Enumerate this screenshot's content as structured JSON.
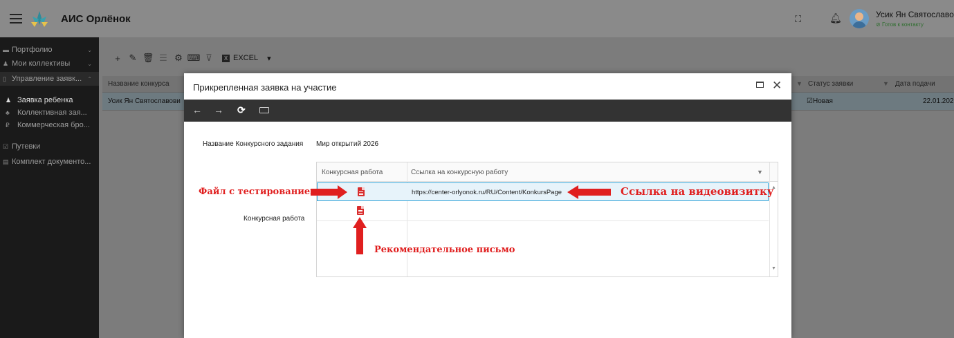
{
  "app": {
    "title": "АИС Орлёнок"
  },
  "user": {
    "name": "Усик Ян Святославович",
    "status": "Готов к контакту"
  },
  "sidebar": {
    "items": [
      {
        "label": "Портфолио",
        "icon": "folder-icon",
        "has_chevron": true
      },
      {
        "label": "Мои коллективы",
        "icon": "team-icon",
        "has_chevron": true
      },
      {
        "label": "Управление заявк...",
        "icon": "document-icon",
        "has_chevron": true
      },
      {
        "label": "Заявка ребенка",
        "icon": "person-icon",
        "active": true
      },
      {
        "label": "Коллективная зая...",
        "icon": "group-icon"
      },
      {
        "label": "Коммерческая бро...",
        "icon": "ruble-icon"
      },
      {
        "label": "Путевки",
        "icon": "checkbox-icon"
      },
      {
        "label": "Комплект документо...",
        "icon": "id-card-icon"
      }
    ]
  },
  "toolbar": {
    "excel_label": "EXCEL",
    "buttons": [
      "add-icon",
      "edit-icon",
      "delete-icon",
      "list-icon",
      "settings-icon",
      "keyboard-icon",
      "filter-clear-icon"
    ]
  },
  "grid": {
    "columns": [
      "Название конкурса",
      "Статус заявки",
      "Дата подачи"
    ],
    "row": {
      "name": "Усик Ян Святославови",
      "status": "Новая",
      "date": "22.01.202"
    }
  },
  "modal": {
    "title": "Прикрепленная заявка на участие",
    "form": {
      "task_label": "Название Конкурсного задания",
      "task_value": "Мир открытий 2026",
      "work_label": "Конкурсная работа"
    },
    "inner_grid": {
      "columns": [
        "Конкурсная работа",
        "Ссылка на конкурсную работу"
      ],
      "rows": [
        {
          "file_icon": "pdf-icon",
          "link": "https://center-orlyonok.ru/RU/Content/KonkursPage"
        },
        {
          "file_icon": "pdf-icon",
          "link": ""
        }
      ]
    }
  },
  "annotations": {
    "file_test": "Файл с тестированием",
    "video_link": "Ссылка на видеовизитку",
    "recommendation": "Рекомендательное письмо",
    "color": "#e01f1f"
  }
}
